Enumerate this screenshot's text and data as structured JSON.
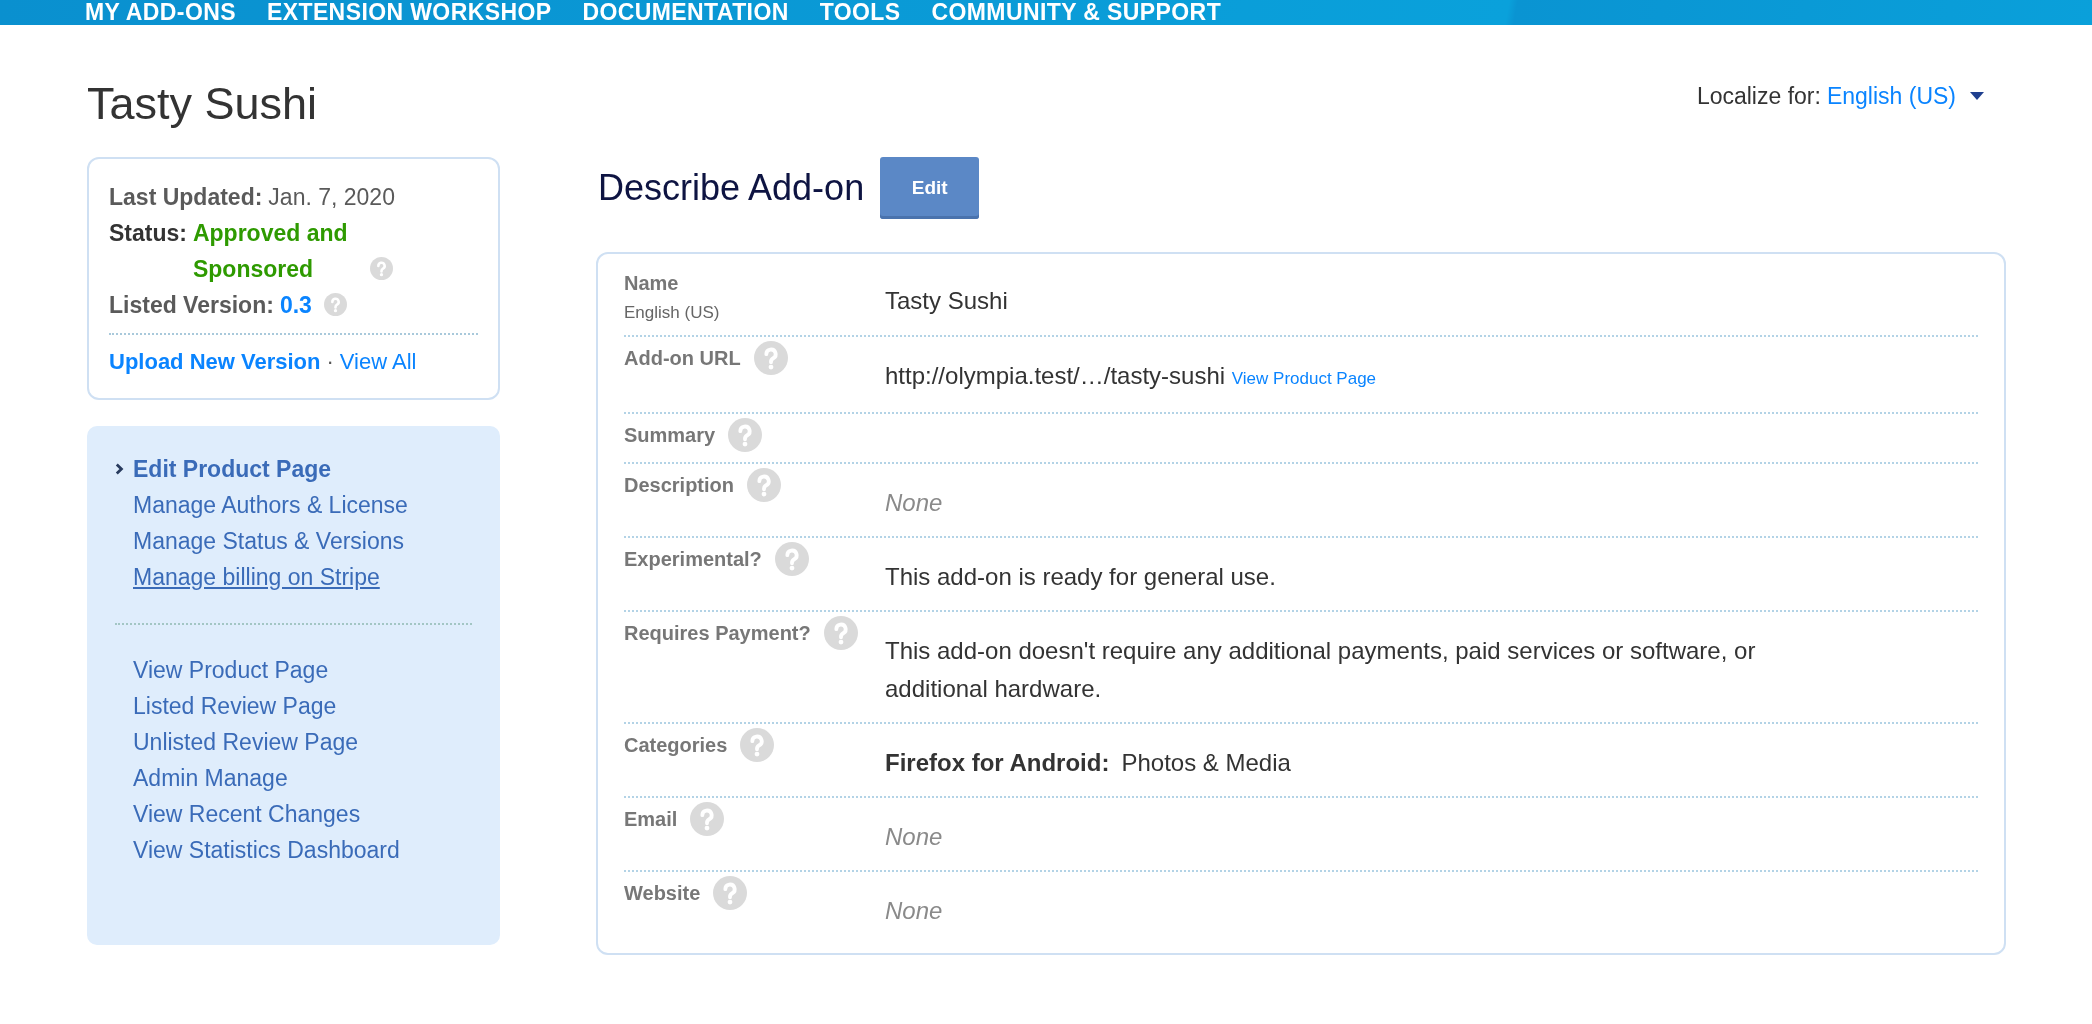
{
  "top_nav": {
    "items": [
      "MY ADD-ONS",
      "EXTENSION WORKSHOP",
      "DOCUMENTATION",
      "TOOLS",
      "COMMUNITY & SUPPORT"
    ]
  },
  "page_title": "Tasty Sushi",
  "localize": {
    "label": "Localize for:",
    "value": "English (US)"
  },
  "info_card": {
    "fields": [
      {
        "kind": "date",
        "label": "Last Updated:",
        "value": "Jan. 7, 2020",
        "help": false
      },
      {
        "kind": "status",
        "label": "Status:",
        "value": "Approved and Sponsored",
        "help": true
      },
      {
        "kind": "version",
        "label": "Listed Version:",
        "value": "0.3",
        "help": true
      }
    ],
    "links": [
      {
        "label": "Upload New Version",
        "kind": "primary"
      },
      {
        "label": "View All",
        "kind": "secondary"
      }
    ],
    "link_separator": "·"
  },
  "side_nav": {
    "groups": [
      {
        "items": [
          {
            "label": "Edit Product Page",
            "selected": true,
            "hovered": false
          },
          {
            "label": "Manage Authors & License",
            "selected": false,
            "hovered": false
          },
          {
            "label": "Manage Status & Versions",
            "selected": false,
            "hovered": false
          },
          {
            "label": "Manage billing on Stripe",
            "selected": false,
            "hovered": true
          }
        ]
      },
      {
        "items": [
          {
            "label": "View Product Page",
            "selected": false,
            "hovered": false
          },
          {
            "label": "Listed Review Page",
            "selected": false,
            "hovered": false
          },
          {
            "label": "Unlisted Review Page",
            "selected": false,
            "hovered": false
          },
          {
            "label": "Admin Manage",
            "selected": false,
            "hovered": false
          },
          {
            "label": "View Recent Changes",
            "selected": false,
            "hovered": false
          },
          {
            "label": "View Statistics Dashboard",
            "selected": false,
            "hovered": false
          }
        ]
      }
    ]
  },
  "section": {
    "title": "Describe Add-on",
    "edit_button": "Edit",
    "rows": [
      {
        "label": "Name",
        "sublabel": "English (US)",
        "help": false,
        "kind": "text",
        "value": "Tasty Sushi"
      },
      {
        "label": "Add-on URL",
        "help": true,
        "kind": "url",
        "value": "http://olympia.test/…/tasty-sushi",
        "link": "View Product Page"
      },
      {
        "label": "Summary",
        "help": true,
        "kind": "blank"
      },
      {
        "label": "Description",
        "help": true,
        "kind": "none",
        "value": "None"
      },
      {
        "label": "Experimental?",
        "help": true,
        "kind": "text",
        "value": "This add-on is ready for general use."
      },
      {
        "label": "Requires Payment?",
        "help": true,
        "kind": "text",
        "value": "This add-on doesn't require any additional payments, paid services or software, or additional hardware."
      },
      {
        "label": "Categories",
        "help": true,
        "kind": "category",
        "app": "Firefox for Android:",
        "value": "Photos & Media"
      },
      {
        "label": "Email",
        "help": true,
        "kind": "none",
        "value": "None"
      },
      {
        "label": "Website",
        "help": true,
        "kind": "none",
        "value": "None"
      }
    ]
  }
}
